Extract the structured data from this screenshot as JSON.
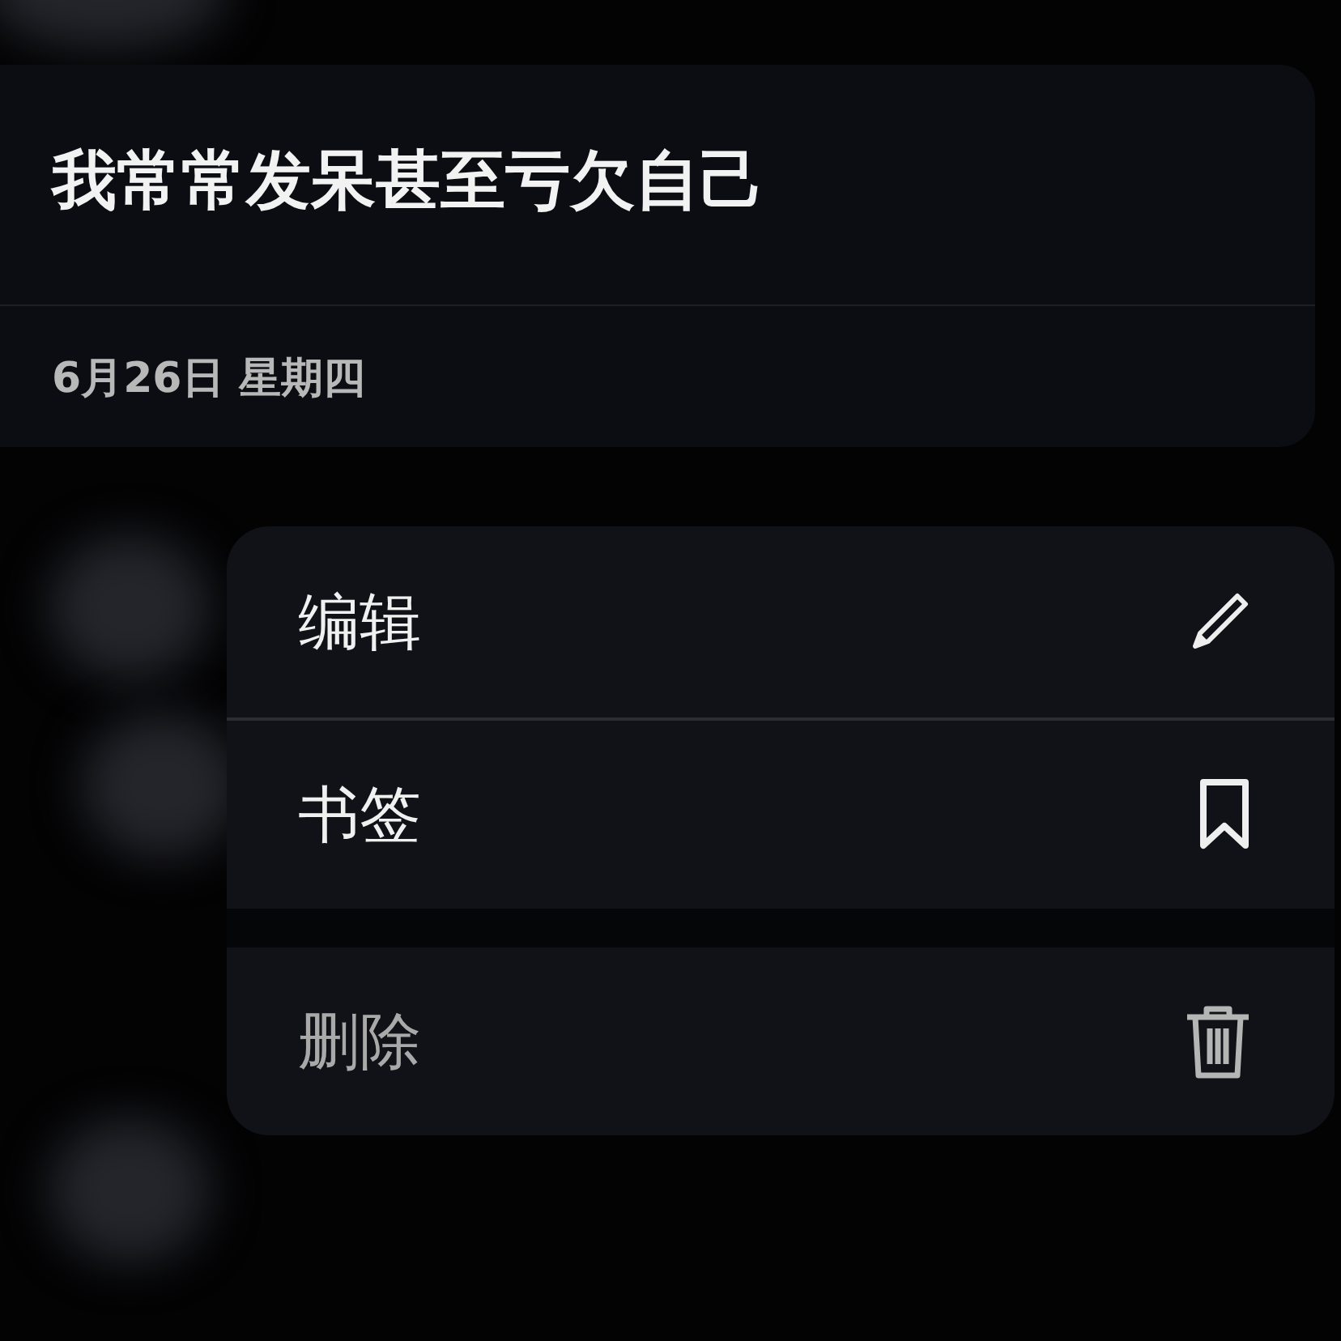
{
  "note": {
    "title": "我常常发呆甚至亏欠自己",
    "date": "6月26日 星期四"
  },
  "context_menu": {
    "groups": [
      [
        {
          "label": "编辑",
          "kind": "edit"
        },
        {
          "label": "书签",
          "kind": "bookmark"
        }
      ],
      [
        {
          "label": "删除",
          "kind": "delete"
        }
      ]
    ]
  }
}
